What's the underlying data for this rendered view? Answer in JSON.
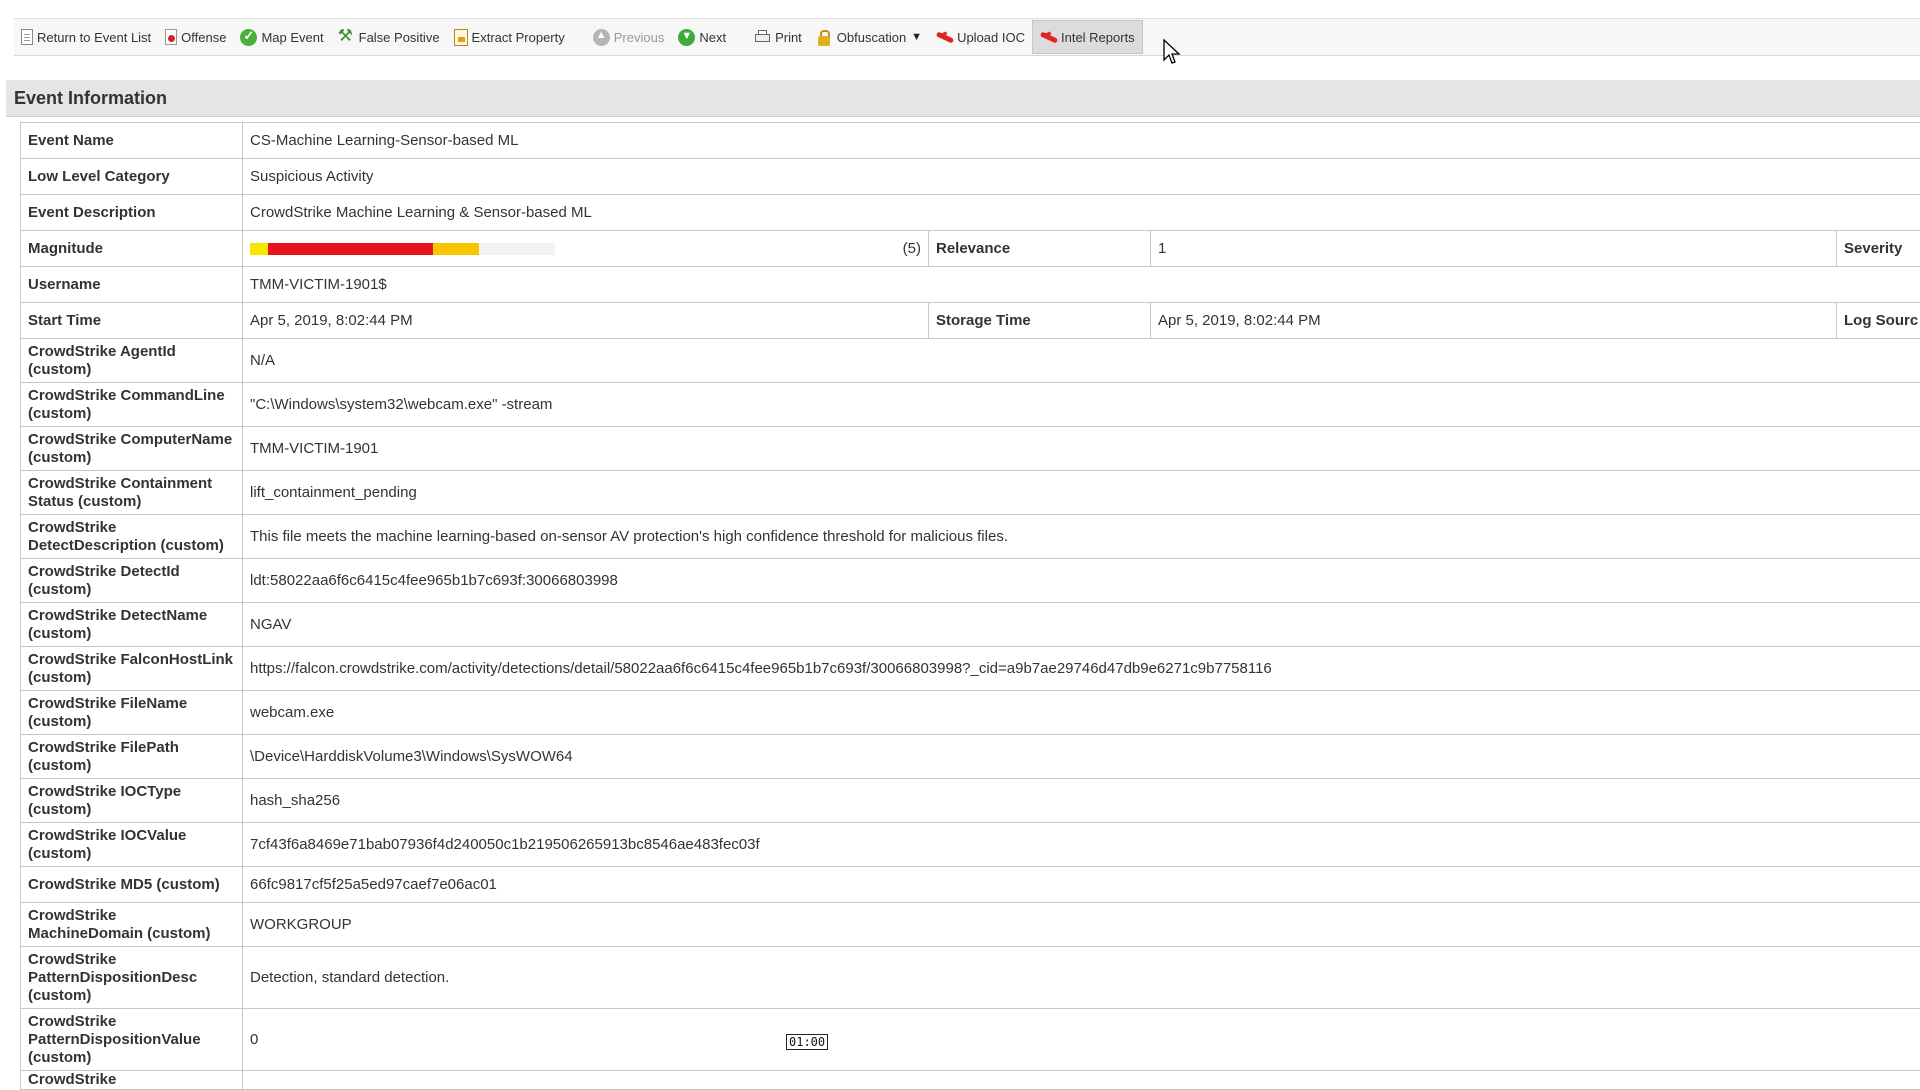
{
  "toolbar": {
    "buttons": [
      {
        "label": "Return to Event List",
        "icon": "page-icon"
      },
      {
        "label": "Offense",
        "icon": "offense-icon"
      },
      {
        "label": "Map Event",
        "icon": "map-event-icon"
      },
      {
        "label": "False Positive",
        "icon": "wrench-icon"
      },
      {
        "label": "Extract Property",
        "icon": "extract-icon"
      },
      {
        "label": "Previous",
        "icon": "previous-icon"
      },
      {
        "label": "Next",
        "icon": "next-icon"
      },
      {
        "label": "Print",
        "icon": "printer-icon"
      },
      {
        "label": "Obfuscation",
        "icon": "lock-icon"
      },
      {
        "label": "Upload IOC",
        "icon": "falcon-icon"
      },
      {
        "label": "Intel Reports",
        "icon": "falcon-icon"
      }
    ]
  },
  "section": {
    "title": "Event Information"
  },
  "rows": {
    "event_name": {
      "label": "Event Name",
      "value": "CS-Machine Learning-Sensor-based ML"
    },
    "low_level_category": {
      "label": "Low Level Category",
      "value": "Suspicious Activity"
    },
    "event_description": {
      "label": "Event Description",
      "value": "CrowdStrike Machine Learning & Sensor-based ML"
    },
    "magnitude": {
      "label": "Magnitude",
      "value_text": "(5)",
      "value": 5,
      "max": 10,
      "relevance_label": "Relevance",
      "relevance_value": "1",
      "severity_label": "Severity"
    },
    "username": {
      "label": "Username",
      "value": "TMM-VICTIM-1901$"
    },
    "start_time": {
      "label": "Start Time",
      "value": "Apr 5, 2019, 8:02:44 PM",
      "storage_label": "Storage Time",
      "storage_value": "Apr 5, 2019, 8:02:44 PM",
      "log_source_label": "Log Sourc"
    },
    "custom": [
      {
        "label": "CrowdStrike AgentId (custom)",
        "value": "N/A",
        "h": "h2"
      },
      {
        "label": "CrowdStrike CommandLine (custom)",
        "value": "\"C:\\Windows\\system32\\webcam.exe\" -stream",
        "h": "h2"
      },
      {
        "label": "CrowdStrike ComputerName  (custom)",
        "value": "TMM-VICTIM-1901",
        "h": "h2"
      },
      {
        "label": "CrowdStrike Containment Status (custom)",
        "value": "lift_containment_pending",
        "h": "h2"
      },
      {
        "label": "CrowdStrike DetectDescription (custom)",
        "value": "This file meets the machine learning-based on-sensor AV protection's high confidence threshold for malicious files.",
        "h": "h2"
      },
      {
        "label": "CrowdStrike DetectId (custom)",
        "value": "ldt:58022aa6f6c6415c4fee965b1b7c693f:30066803998",
        "h": "h2"
      },
      {
        "label": "CrowdStrike DetectName (custom)",
        "value": "NGAV",
        "h": "h2"
      },
      {
        "label": "CrowdStrike FalconHostLink (custom)",
        "value": "https://falcon.crowdstrike.com/activity/detections/detail/58022aa6f6c6415c4fee965b1b7c693f/30066803998?_cid=a9b7ae29746d47db9e6271c9b7758116",
        "h": "h2"
      },
      {
        "label": "CrowdStrike FileName (custom)",
        "value": "webcam.exe",
        "h": "h2"
      },
      {
        "label": "CrowdStrike FilePath (custom)",
        "value": "\\Device\\HarddiskVolume3\\Windows\\SysWOW64",
        "h": "h2"
      },
      {
        "label": "CrowdStrike IOCType (custom)",
        "value": "hash_sha256",
        "h": "h2"
      },
      {
        "label": "CrowdStrike IOCValue (custom)",
        "value": "7cf43f6a8469e71bab07936f4d240050c1b219506265913bc8546ae483fec03f",
        "h": "h2"
      },
      {
        "label": "CrowdStrike MD5 (custom)",
        "value": "66fc9817cf5f25a5ed97caef7e06ac01",
        "h": "h1"
      },
      {
        "label": "CrowdStrike MachineDomain (custom)",
        "value": "WORKGROUP",
        "h": "h2"
      },
      {
        "label": "CrowdStrike PatternDispositionDesc (custom)",
        "value": "Detection, standard detection.",
        "h": "h3"
      },
      {
        "label": "CrowdStrike PatternDispositionValue (custom)",
        "value": "0",
        "h": "h3"
      },
      {
        "label": "CrowdStrike",
        "value": "",
        "h": "hc"
      }
    ]
  },
  "video_timestamp": "01:00",
  "colors": {
    "mag_yellow": "#f7e600",
    "mag_red": "#e8141c",
    "mag_orange": "#f9c400",
    "header_bg": "#e5e5e5"
  }
}
